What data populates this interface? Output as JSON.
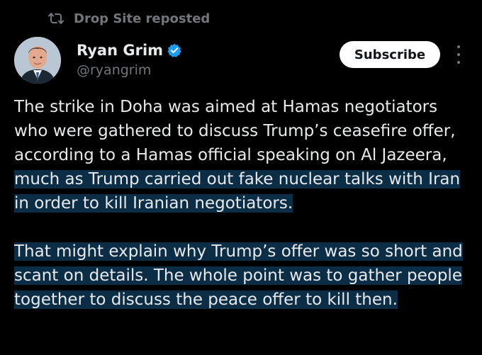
{
  "repost": {
    "icon": "repost-icon",
    "text": "Drop Site reposted"
  },
  "author": {
    "name": "Ryan Grim",
    "handle": "@ryangrim",
    "verified_icon": "verified-badge-icon",
    "verified_color": "#1d9bf0"
  },
  "actions": {
    "subscribe_label": "Subscribe",
    "more_icon": "more-vertical-icon"
  },
  "tweet": {
    "p1_plain": "The strike in Doha was aimed at Hamas negotiators who were gathered to discuss Trump’s ceasefire offer, according to a Hamas official speaking on Al Jazeera,",
    "p1_highlight": " much as Trump carried out fake nuclear talks with Iran in order to kill Iranian negotiators.",
    "p2_highlight": "That might explain why Trump’s offer was so short and scant on details. The whole point was to gather people together to discuss the peace offer to kill then."
  },
  "colors": {
    "background": "#000000",
    "text": "#e7e9ea",
    "muted": "#71767b",
    "highlight": "#0b2d46"
  }
}
